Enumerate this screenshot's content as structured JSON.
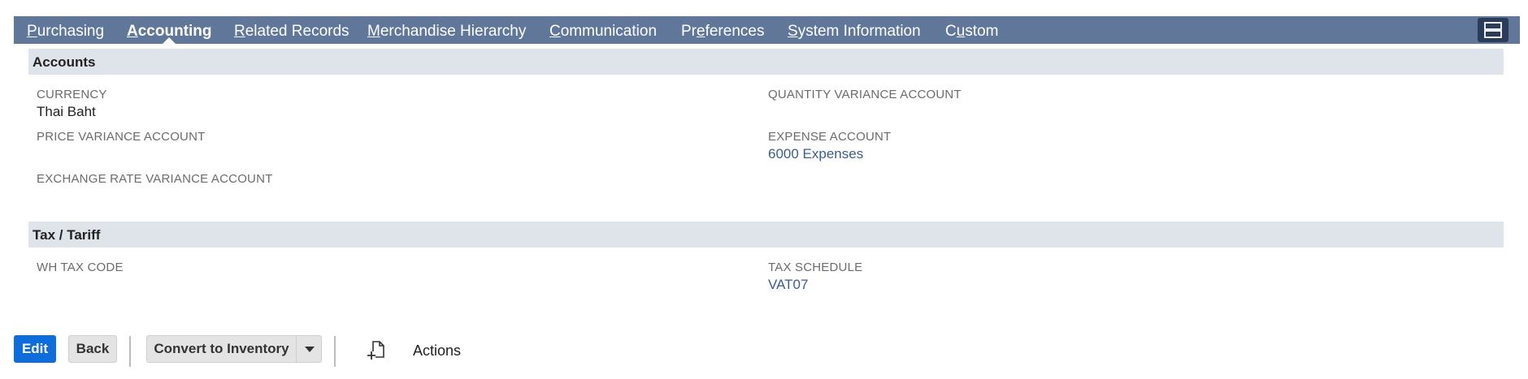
{
  "tabs": [
    {
      "accel": "P",
      "rest": "urchasing",
      "active": false
    },
    {
      "accel": "A",
      "rest": "ccounting",
      "active": true
    },
    {
      "accel": "R",
      "rest": "elated Records",
      "active": false
    },
    {
      "accel": "M",
      "rest": "erchandise Hierarchy",
      "active": false
    },
    {
      "accel": "C",
      "rest": "ommunication",
      "active": false
    },
    {
      "pre": "Pr",
      "accel": "e",
      "rest": "ferences",
      "active": false
    },
    {
      "accel": "S",
      "rest": "ystem Information",
      "active": false
    },
    {
      "pre": "C",
      "accel": "u",
      "rest": "stom",
      "active": false
    }
  ],
  "menu_icon": "view-toggle-icon",
  "accounts": {
    "title": "Accounts",
    "currency_label": "CURRENCY",
    "currency_value": "Thai Baht",
    "price_variance_label": "PRICE VARIANCE ACCOUNT",
    "exchange_rate_label": "EXCHANGE RATE VARIANCE ACCOUNT",
    "quantity_variance_label": "QUANTITY VARIANCE ACCOUNT",
    "expense_label": "EXPENSE ACCOUNT",
    "expense_value": "6000 Expenses"
  },
  "tax": {
    "title": "Tax / Tariff",
    "wh_tax_label": "WH TAX CODE",
    "tax_schedule_label": "TAX SCHEDULE",
    "tax_schedule_value": "VAT07"
  },
  "toolbar": {
    "edit_label": "Edit",
    "back_label": "Back",
    "convert_label": "Convert to Inventory",
    "actions_label": "Actions",
    "new_icon": "new-document-icon",
    "caret_icon": "caret-down-icon"
  },
  "colors": {
    "tabbar": "#607799",
    "section": "#dfe3ea",
    "link": "#3a5d8f",
    "primary_button": "#0f6cdb"
  }
}
